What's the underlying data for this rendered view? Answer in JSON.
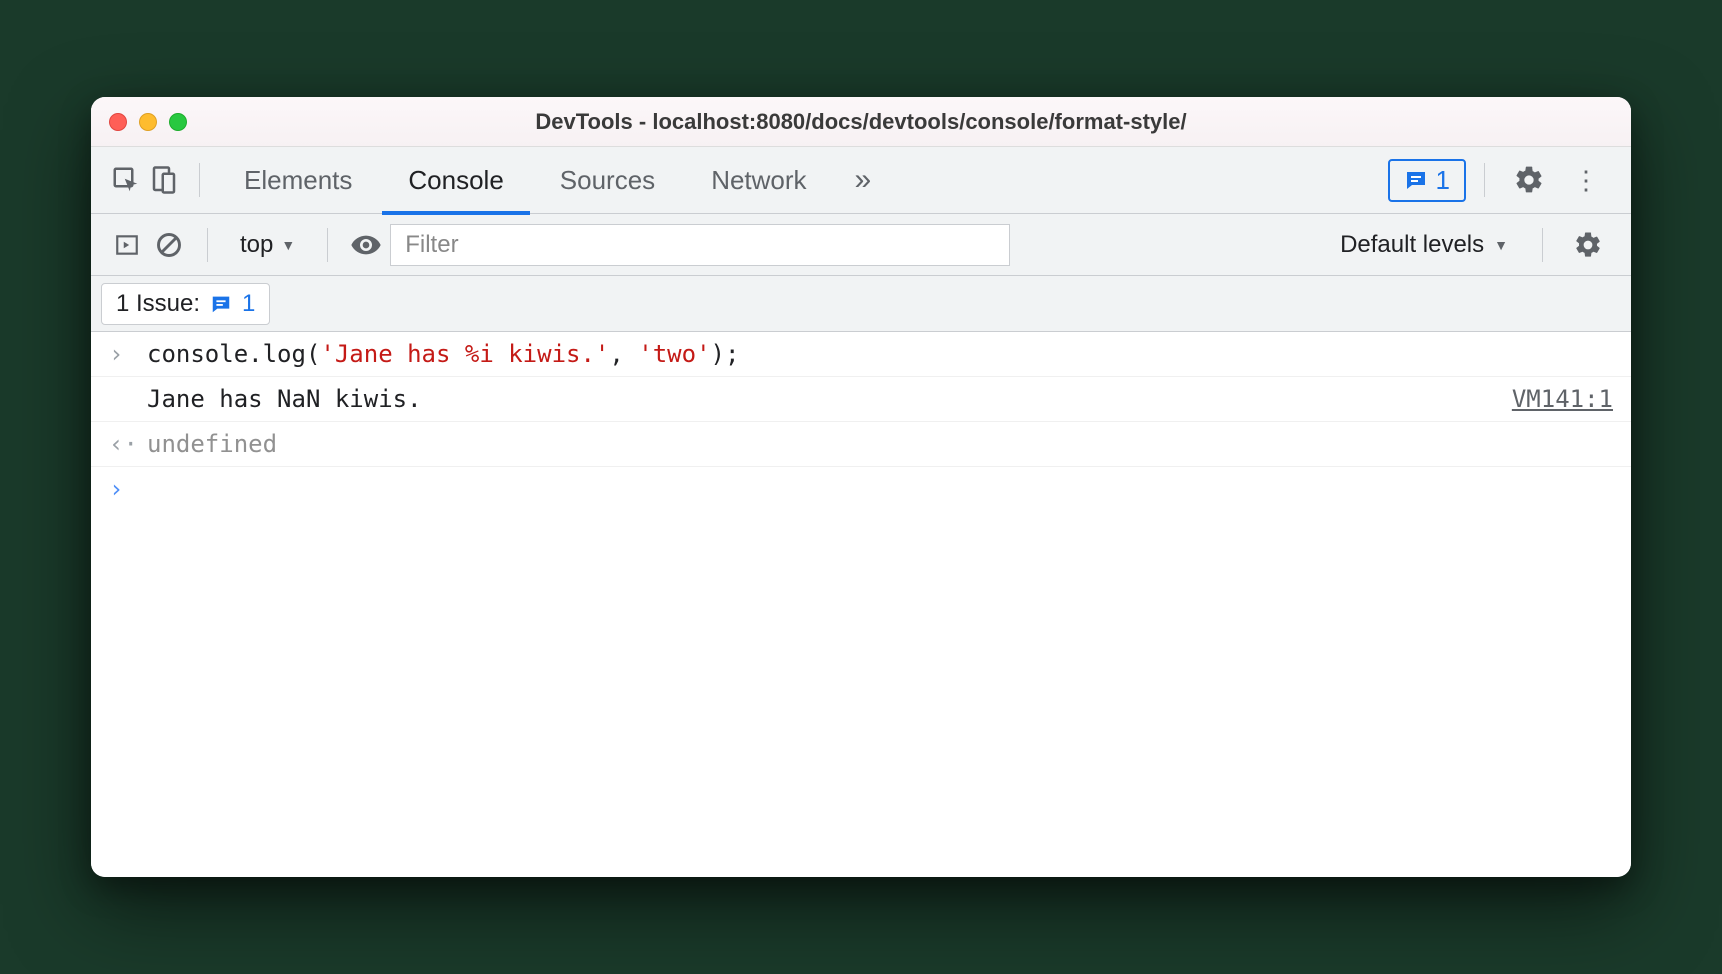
{
  "window": {
    "title": "DevTools - localhost:8080/docs/devtools/console/format-style/"
  },
  "tabs": {
    "elements": "Elements",
    "console": "Console",
    "sources": "Sources",
    "network": "Network"
  },
  "issues_badge": {
    "count": "1"
  },
  "toolbar": {
    "context": "top",
    "filter_placeholder": "Filter",
    "levels": "Default levels"
  },
  "issues_bar": {
    "label": "1 Issue:",
    "count": "1"
  },
  "console": {
    "input_prefix": "console.log(",
    "input_str1": "'Jane has %i kiwis.'",
    "input_comma": ", ",
    "input_str2": "'two'",
    "input_suffix": ");",
    "output": "Jane has NaN kiwis.",
    "source_link": "VM141:1",
    "return_value": "undefined"
  }
}
